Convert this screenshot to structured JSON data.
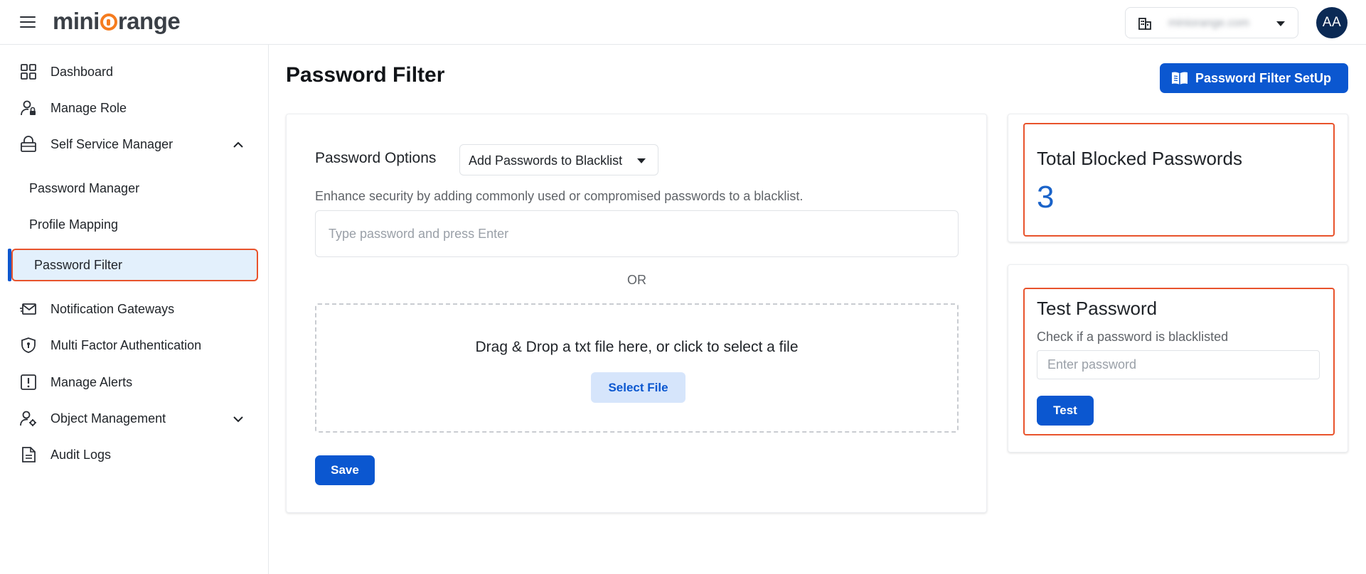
{
  "header": {
    "logo_mini": "mini",
    "logo_rest": "range",
    "org_name": "miniorange.com",
    "avatar_initials": "AA"
  },
  "sidebar": {
    "items": [
      {
        "label": "Dashboard",
        "icon": "dashboard-grid-icon"
      },
      {
        "label": "Manage Role",
        "icon": "user-lock-icon"
      },
      {
        "label": "Self Service Manager",
        "icon": "lock-icon",
        "expanded": true
      },
      {
        "label": "Notification Gateways",
        "icon": "envelope-send-icon"
      },
      {
        "label": "Multi Factor Authentication",
        "icon": "shield-icon"
      },
      {
        "label": "Manage Alerts",
        "icon": "alert-icon"
      },
      {
        "label": "Object Management",
        "icon": "user-gear-icon",
        "expanded": false
      },
      {
        "label": "Audit Logs",
        "icon": "document-icon"
      }
    ],
    "sub_items": [
      {
        "label": "Password Manager"
      },
      {
        "label": "Profile Mapping"
      },
      {
        "label": "Password Filter",
        "active": true
      }
    ]
  },
  "main": {
    "title": "Password Filter",
    "setup_button": "Password Filter SetUp",
    "options_label": "Password Options",
    "options_selected": "Add Passwords to Blacklist",
    "description": "Enhance security by adding commonly used or compromised passwords to a blacklist.",
    "password_placeholder": "Type password and press Enter",
    "or_text": "OR",
    "dropzone_text": "Drag & Drop a txt file here, or click to select a file",
    "select_file_button": "Select File",
    "save_button": "Save"
  },
  "stats": {
    "total_title": "Total Blocked Passwords",
    "total_count": "3"
  },
  "test": {
    "title": "Test Password",
    "description": "Check if a password is blacklisted",
    "placeholder": "Enter password",
    "button": "Test"
  },
  "colors": {
    "primary": "#0b57d0",
    "highlight": "#e8532c",
    "active_bg": "#e3f0fc",
    "count": "#1a63c9",
    "logo_orange": "#f57c1f"
  }
}
